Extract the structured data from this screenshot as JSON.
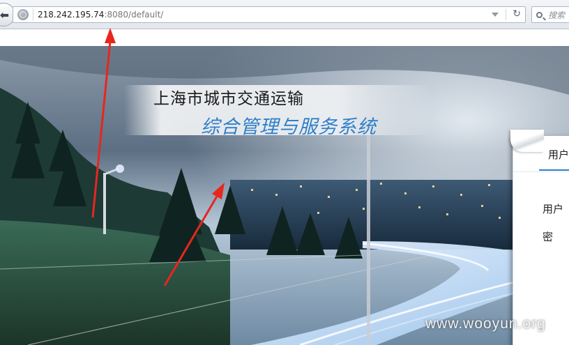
{
  "browser": {
    "url_host": "218.242.195.74",
    "url_rest": ":8080/default/",
    "search_placeholder": "搜索"
  },
  "banner": {
    "title": "上海市城市交通运输",
    "subtitle": "综合管理与服务系统"
  },
  "login": {
    "tab_label": "用户",
    "username_label": "用户",
    "password_label": "密 码"
  },
  "watermark": "www.wooyun.org",
  "colors": {
    "accent": "#2f7fc9",
    "annotation": "#e8261e"
  }
}
